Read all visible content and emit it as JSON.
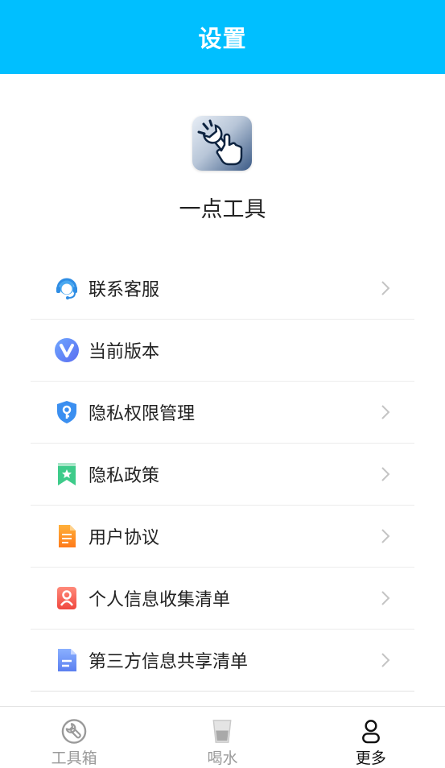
{
  "header": {
    "title": "设置"
  },
  "app": {
    "name": "一点工具",
    "icon": "wrench-hand-icon"
  },
  "menu": {
    "items": [
      {
        "label": "联系客服",
        "icon": "customer-service-icon",
        "chevron": true
      },
      {
        "label": "当前版本",
        "icon": "version-icon",
        "chevron": false
      },
      {
        "label": "隐私权限管理",
        "icon": "shield-key-icon",
        "chevron": true
      },
      {
        "label": "隐私政策",
        "icon": "bookmark-star-icon",
        "chevron": true
      },
      {
        "label": "用户协议",
        "icon": "document-icon",
        "chevron": true
      },
      {
        "label": "个人信息收集清单",
        "icon": "person-card-icon",
        "chevron": true
      },
      {
        "label": "第三方信息共享清单",
        "icon": "share-list-icon",
        "chevron": true
      }
    ]
  },
  "tabbar": {
    "tabs": [
      {
        "label": "工具箱",
        "icon": "wrench-icon",
        "active": false
      },
      {
        "label": "喝水",
        "icon": "water-glass-icon",
        "active": false
      },
      {
        "label": "更多",
        "icon": "user-icon",
        "active": true
      }
    ]
  },
  "colors": {
    "header_bg": "#00BFFF",
    "active_tab": "#111111",
    "inactive_tab": "#9A9A9A"
  }
}
